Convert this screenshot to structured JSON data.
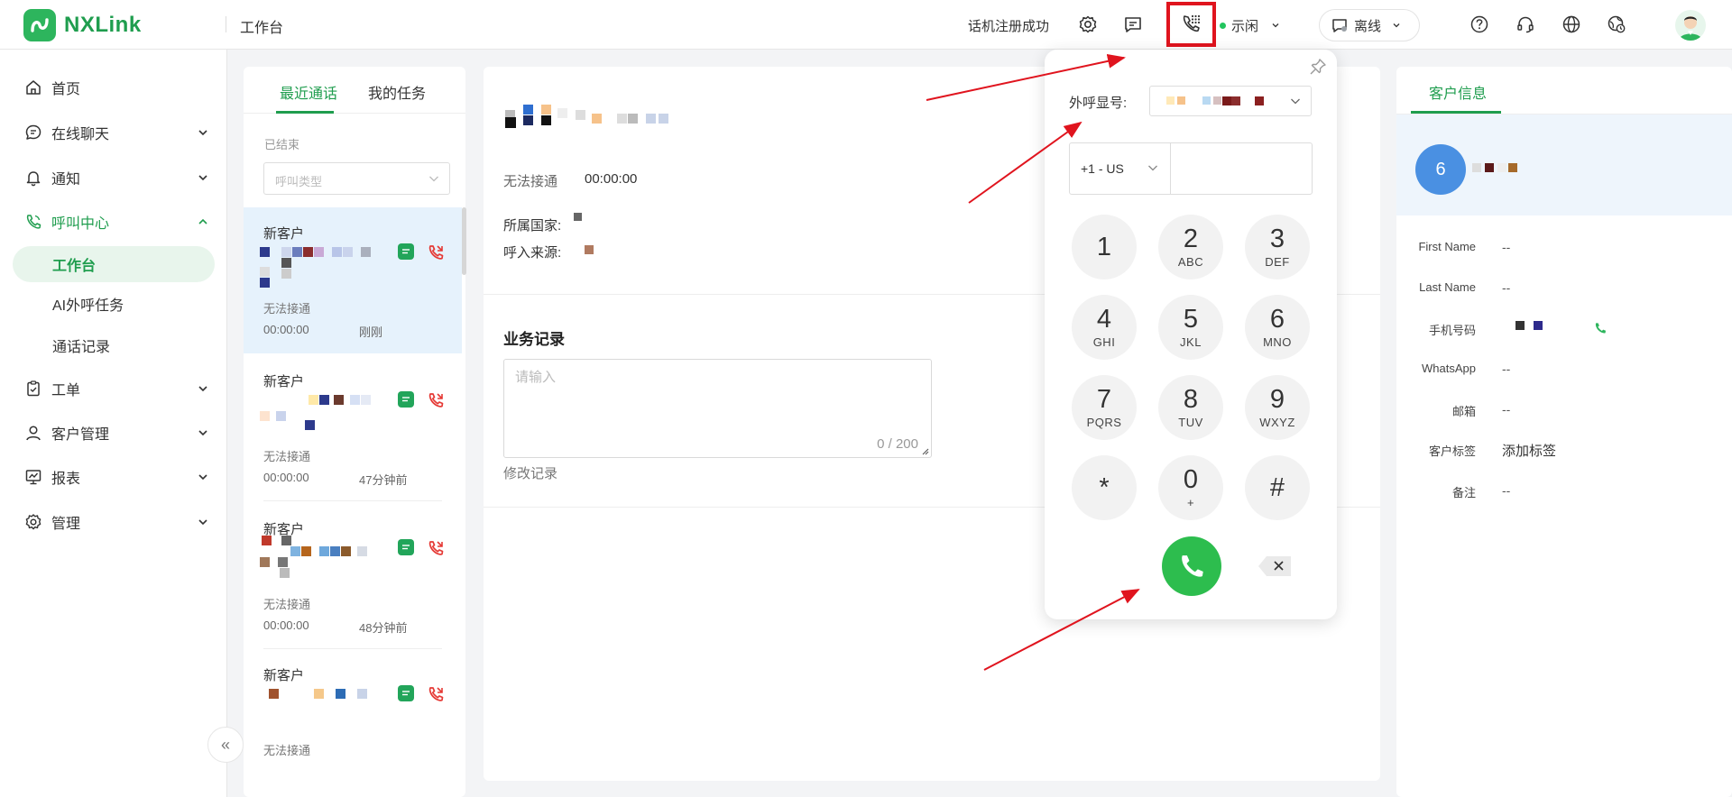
{
  "app": {
    "brand": "NXLink",
    "workspace_title": "工作台"
  },
  "topbar": {
    "registration_status": "话机注册成功",
    "presence_status": "示闲",
    "online_status": "离线",
    "presence_color": "#22c55e"
  },
  "sidebar": {
    "items": [
      {
        "label": "首页",
        "icon": "home-icon"
      },
      {
        "label": "在线聊天",
        "icon": "chat-icon"
      },
      {
        "label": "通知",
        "icon": "bell-icon"
      },
      {
        "label": "呼叫中心",
        "icon": "phone-icon"
      },
      {
        "label": "工单",
        "icon": "clipboard-icon"
      },
      {
        "label": "客户管理",
        "icon": "user-icon"
      },
      {
        "label": "报表",
        "icon": "report-icon"
      },
      {
        "label": "管理",
        "icon": "gear-icon"
      }
    ],
    "call_center_sub": [
      "工作台",
      "AI外呼任务",
      "通话记录"
    ],
    "collapse_glyph": "«"
  },
  "calls": {
    "tabs": [
      "最近通话",
      "我的任务"
    ],
    "section_label": "已结束",
    "type_placeholder": "呼叫类型",
    "items": [
      {
        "name": "新客户",
        "status": "无法接通",
        "duration": "00:00:00",
        "time": "刚刚"
      },
      {
        "name": "新客户",
        "status": "无法接通",
        "duration": "00:00:00",
        "time": "47分钟前"
      },
      {
        "name": "新客户",
        "status": "无法接通",
        "duration": "00:00:00",
        "time": "48分钟前"
      },
      {
        "name": "新客户",
        "status": "无法接通",
        "duration": "",
        "time": ""
      }
    ]
  },
  "detail": {
    "call_status": "无法接通",
    "call_duration": "00:00:00",
    "country_label": "所属国家:",
    "source_label": "呼入来源:",
    "business_title": "业务记录",
    "record_placeholder": "请输入",
    "record_count": "0 / 200",
    "edit_record": "修改记录"
  },
  "dialer": {
    "caller_id_label": "外呼显号:",
    "country_code": "+1 - US",
    "keys": [
      {
        "digit": "1",
        "letters": ""
      },
      {
        "digit": "2",
        "letters": "ABC"
      },
      {
        "digit": "3",
        "letters": "DEF"
      },
      {
        "digit": "4",
        "letters": "GHI"
      },
      {
        "digit": "5",
        "letters": "JKL"
      },
      {
        "digit": "6",
        "letters": "MNO"
      },
      {
        "digit": "7",
        "letters": "PQRS"
      },
      {
        "digit": "8",
        "letters": "TUV"
      },
      {
        "digit": "9",
        "letters": "WXYZ"
      },
      {
        "digit": "*",
        "letters": ""
      },
      {
        "digit": "0",
        "letters": "+"
      },
      {
        "digit": "#",
        "letters": ""
      }
    ],
    "call_color": "#2dbd4e"
  },
  "customer": {
    "tab": "客户信息",
    "avatar_text": "6",
    "fields": [
      {
        "label": "First Name",
        "value": "--"
      },
      {
        "label": "Last Name",
        "value": "--"
      },
      {
        "label": "手机号码",
        "value": ""
      },
      {
        "label": "WhatsApp",
        "value": "--"
      },
      {
        "label": "邮箱",
        "value": "--"
      },
      {
        "label": "客户标签",
        "value": "添加标签"
      },
      {
        "label": "备注",
        "value": "--"
      }
    ]
  },
  "colors": {
    "brand_green": "#1f9d4e",
    "highlight_red": "#e0141e",
    "hangup_red": "#e53935"
  }
}
